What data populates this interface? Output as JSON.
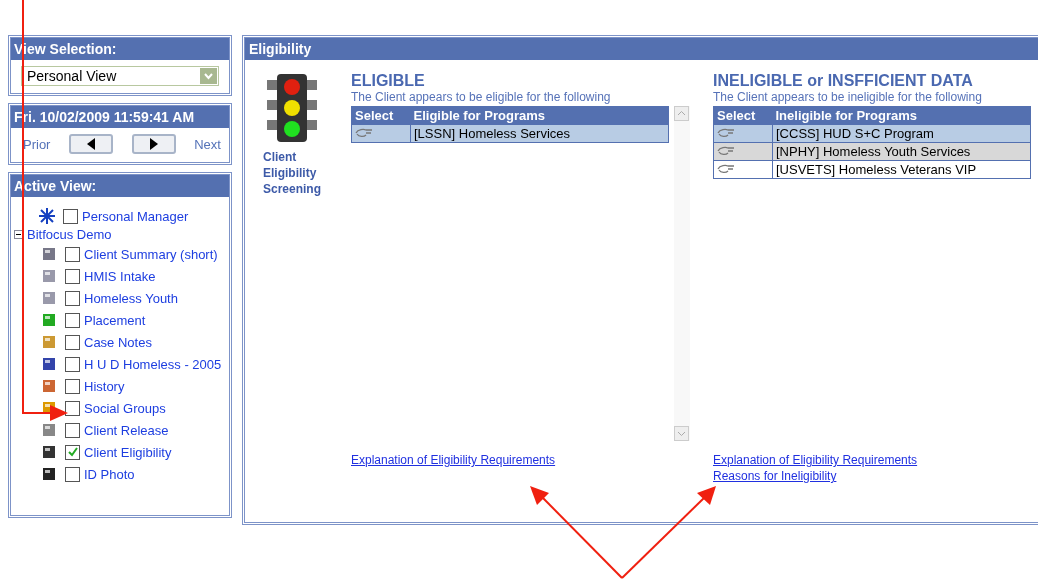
{
  "view_selection": {
    "title": "View Selection:",
    "value": "Personal View"
  },
  "date_panel": {
    "title": "Fri. 10/02/2009 11:59:41 AM",
    "prior": "Prior",
    "next": "Next"
  },
  "active_view": {
    "title": "Active View:",
    "items": [
      {
        "label": "Personal Manager",
        "checked": false
      },
      {
        "label": "Bitfocus Demo",
        "expanded": true,
        "children": [
          {
            "label": "Client Summary (short)",
            "checked": false
          },
          {
            "label": "HMIS Intake",
            "checked": false
          },
          {
            "label": "Homeless Youth",
            "checked": false
          },
          {
            "label": "Placement",
            "checked": false
          },
          {
            "label": "Case Notes",
            "checked": false
          },
          {
            "label": "H U D Homeless - 2005",
            "checked": false
          },
          {
            "label": "History",
            "checked": false
          },
          {
            "label": "Social Groups",
            "checked": false
          },
          {
            "label": "Client Release",
            "checked": false
          },
          {
            "label": "Client Eligibility",
            "checked": true
          },
          {
            "label": "ID Photo",
            "checked": false
          }
        ]
      }
    ]
  },
  "main": {
    "title": "Eligibility",
    "caption": "Client Eligibility Screening",
    "eligible": {
      "heading": "ELIGIBLE",
      "subtitle": "The Client appears to be eligible for the following",
      "columns": [
        "Select",
        "Eligible for Programs"
      ],
      "rows": [
        {
          "program": "[LSSN] Homeless Services",
          "selected": true
        }
      ],
      "links": [
        "Explanation of Eligibility Requirements"
      ]
    },
    "ineligible": {
      "heading": "INELIGIBLE or INSFFICIENT DATA",
      "subtitle": "The Client appears to be ineligible for the following",
      "columns": [
        "Select",
        "Ineligible for Programs"
      ],
      "rows": [
        {
          "program": "[CCSS] HUD S+C Program",
          "selected": true
        },
        {
          "program": "[NPHY] Homeless Youth Services",
          "selected": false
        },
        {
          "program": "[USVETS] Homeless Veterans VIP",
          "selected": false
        }
      ],
      "links": [
        "Explanation of Eligibility Requirements",
        "Reasons for Ineligibility"
      ]
    }
  }
}
